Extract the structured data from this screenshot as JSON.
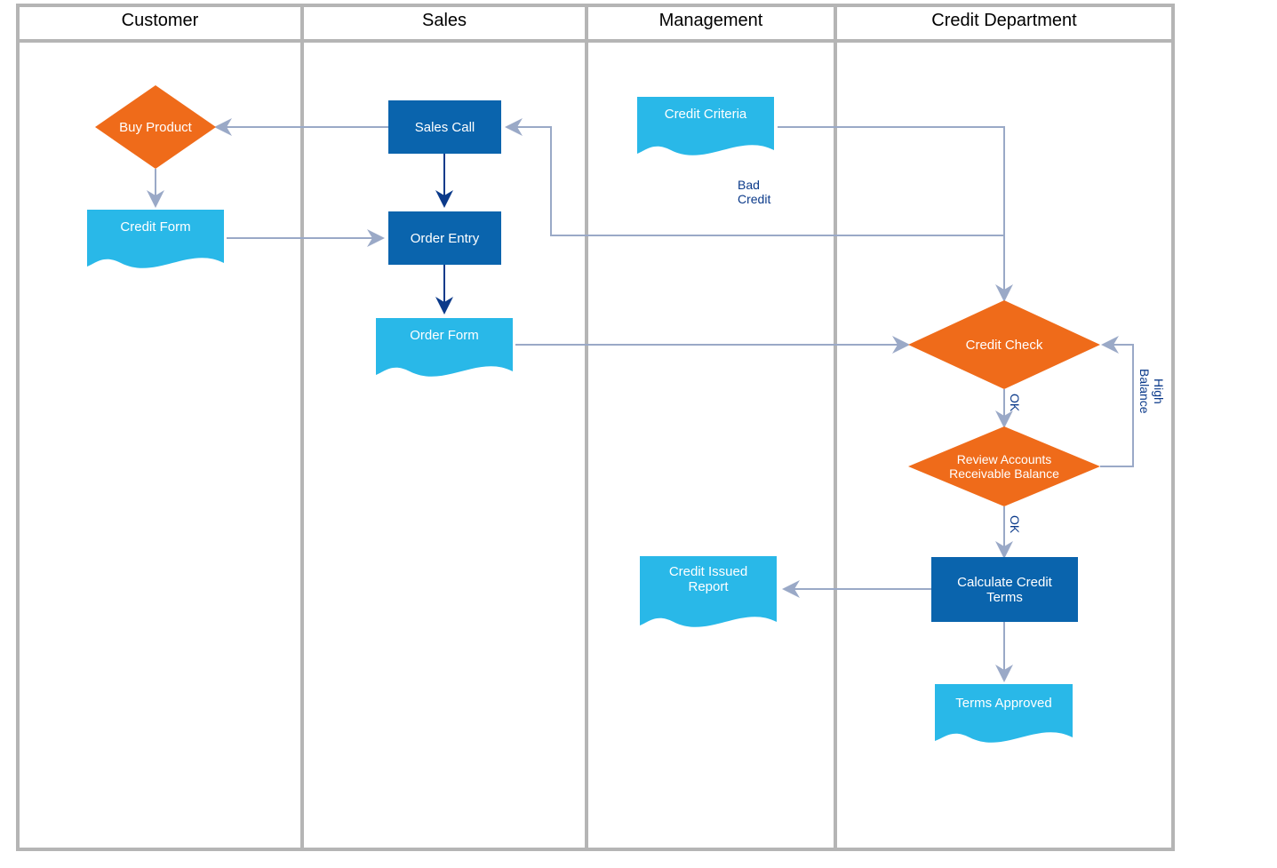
{
  "lanes": {
    "customer": "Customer",
    "sales": "Sales",
    "management": "Management",
    "credit_dept": "Credit Department"
  },
  "nodes": {
    "buy_product": "Buy Product",
    "credit_form": "Credit Form",
    "sales_call": "Sales Call",
    "order_entry": "Order Entry",
    "order_form": "Order Form",
    "credit_criteria": "Credit Criteria",
    "credit_issued_report_l1": "Credit Issued",
    "credit_issued_report_l2": "Report",
    "credit_check": "Credit Check",
    "review_ar_l1": "Review Accounts",
    "review_ar_l2": "Receivable Balance",
    "calc_credit_terms_l1": "Calculate Credit",
    "calc_credit_terms_l2": "Terms",
    "terms_approved": "Terms Approved"
  },
  "edge_labels": {
    "bad_credit_l1": "Bad",
    "bad_credit_l2": "Credit",
    "ok1": "OK",
    "ok2": "OK",
    "high_l1": "High",
    "high_l2": "Balance"
  },
  "colors": {
    "lane_border": "#b5b5b5",
    "process": "#0a64ad",
    "decision": "#ef6b1a",
    "document": "#29b8e8",
    "arrow": "#9aa9c7",
    "arrow_dark": "#0b3a8a"
  },
  "chart_data": {
    "type": "swimlane_flowchart",
    "title": "",
    "lanes": [
      "Customer",
      "Sales",
      "Management",
      "Credit Department"
    ],
    "nodes": [
      {
        "id": "buy_product",
        "lane": "Customer",
        "type": "decision",
        "label": "Buy Product"
      },
      {
        "id": "credit_form",
        "lane": "Customer",
        "type": "document",
        "label": "Credit Form"
      },
      {
        "id": "sales_call",
        "lane": "Sales",
        "type": "process",
        "label": "Sales Call"
      },
      {
        "id": "order_entry",
        "lane": "Sales",
        "type": "process",
        "label": "Order Entry"
      },
      {
        "id": "order_form",
        "lane": "Sales",
        "type": "document",
        "label": "Order Form"
      },
      {
        "id": "credit_criteria",
        "lane": "Management",
        "type": "document",
        "label": "Credit Criteria"
      },
      {
        "id": "credit_issued_report",
        "lane": "Management",
        "type": "document",
        "label": "Credit Issued Report"
      },
      {
        "id": "credit_check",
        "lane": "Credit Department",
        "type": "decision",
        "label": "Credit Check"
      },
      {
        "id": "review_ar",
        "lane": "Credit Department",
        "type": "decision",
        "label": "Review Accounts Receivable Balance"
      },
      {
        "id": "calc_credit_terms",
        "lane": "Credit Department",
        "type": "process",
        "label": "Calculate Credit Terms"
      },
      {
        "id": "terms_approved",
        "lane": "Credit Department",
        "type": "document",
        "label": "Terms Approved"
      }
    ],
    "edges": [
      {
        "from": "sales_call",
        "to": "buy_product",
        "label": ""
      },
      {
        "from": "buy_product",
        "to": "credit_form",
        "label": ""
      },
      {
        "from": "credit_form",
        "to": "order_entry",
        "label": ""
      },
      {
        "from": "sales_call",
        "to": "order_entry",
        "label": ""
      },
      {
        "from": "order_entry",
        "to": "order_form",
        "label": ""
      },
      {
        "from": "order_form",
        "to": "credit_check",
        "label": ""
      },
      {
        "from": "credit_criteria",
        "to": "credit_check",
        "label": ""
      },
      {
        "from": "credit_check",
        "to": "sales_call",
        "label": "Bad Credit"
      },
      {
        "from": "credit_check",
        "to": "review_ar",
        "label": "OK"
      },
      {
        "from": "review_ar",
        "to": "credit_check",
        "label": "High Balance"
      },
      {
        "from": "review_ar",
        "to": "calc_credit_terms",
        "label": "OK"
      },
      {
        "from": "calc_credit_terms",
        "to": "credit_issued_report",
        "label": ""
      },
      {
        "from": "calc_credit_terms",
        "to": "terms_approved",
        "label": ""
      }
    ]
  }
}
